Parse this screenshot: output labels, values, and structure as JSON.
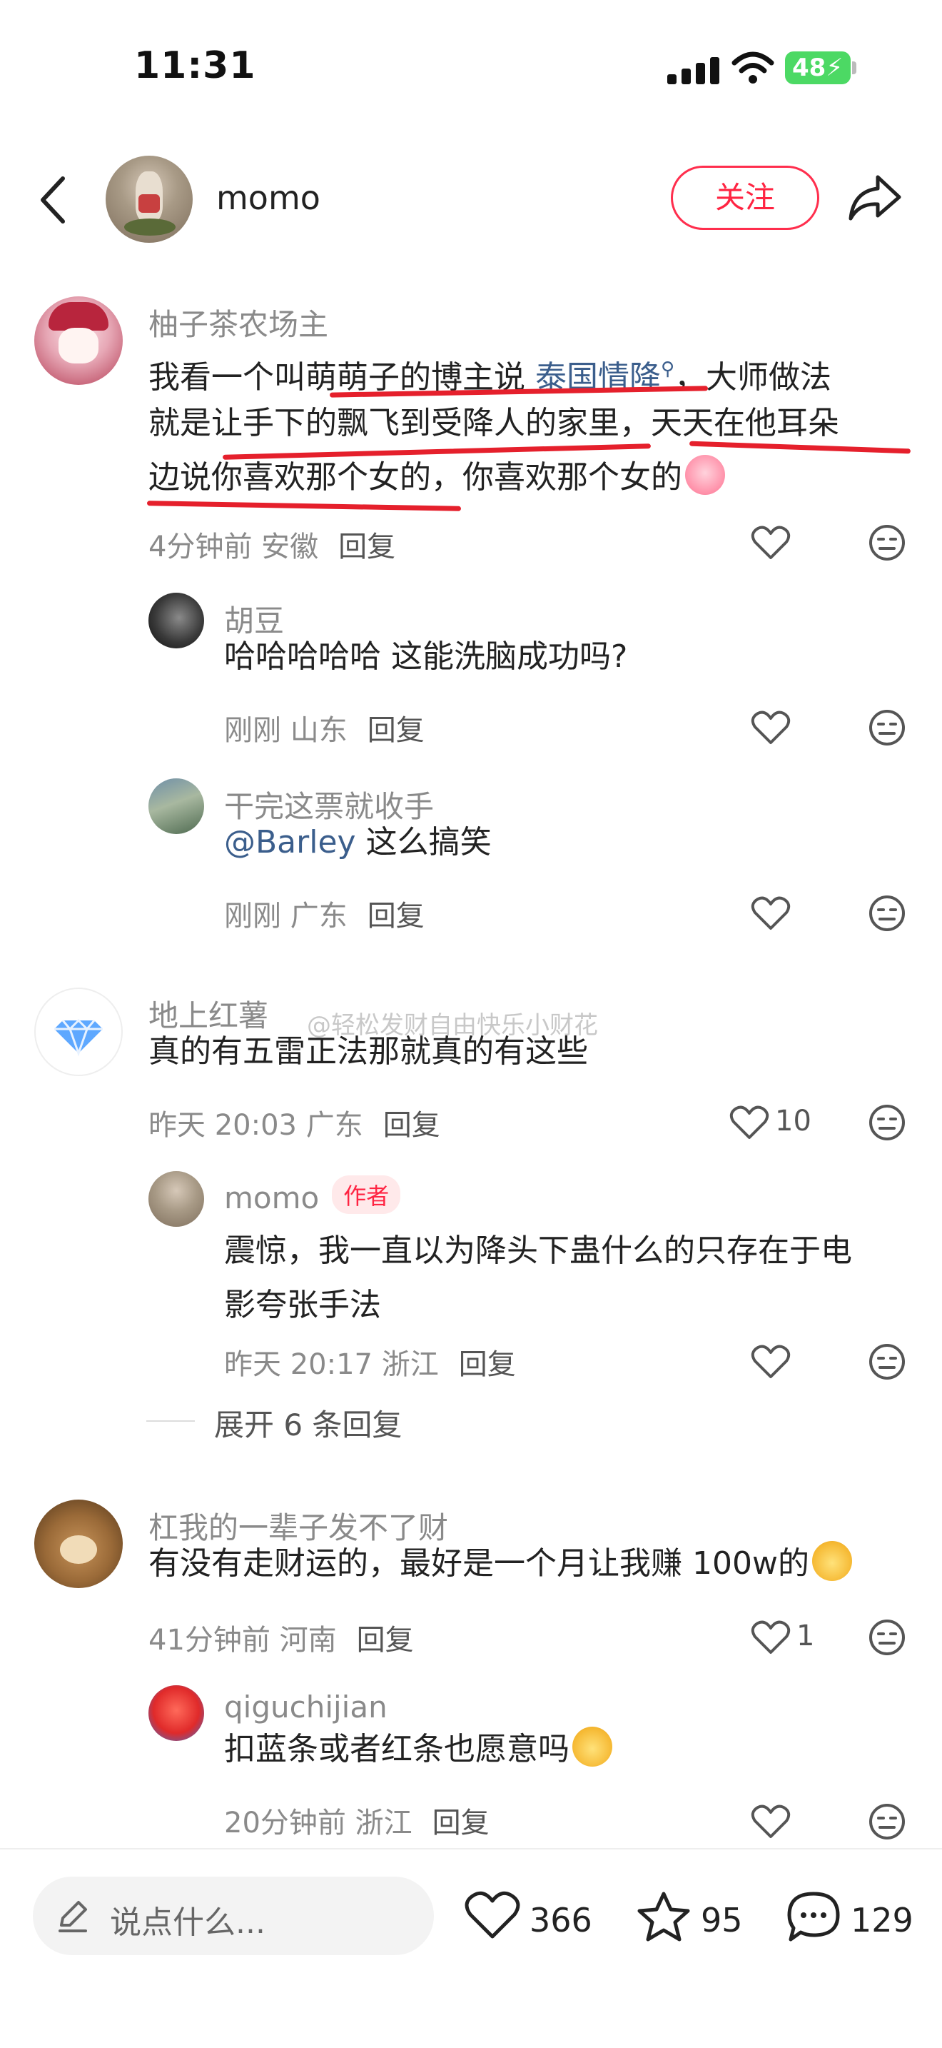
{
  "status_bar": {
    "time": "11:31",
    "battery": "48"
  },
  "header": {
    "author": "momo",
    "follow_label": "关注"
  },
  "comments": [
    {
      "nick": "柚子茶农场主",
      "text_line1_pre": "我看一个叫萌萌子的博主说 ",
      "text_line1_link": "泰国情降",
      "text_line1_post": "，大师做法",
      "text_line2": "就是让手下的飘飞到受降人的家里，天天在他耳朵",
      "text_line3": "边说你喜欢那个女的，你喜欢那个女的",
      "time": "4分钟前 安徽",
      "reply": "回复"
    },
    {
      "nick": "胡豆",
      "text": "哈哈哈哈哈 这能洗脑成功吗?",
      "time": "刚刚 山东",
      "reply": "回复"
    },
    {
      "nick": "干完这票就收手",
      "mention": "@Barley",
      "text": " 这么搞笑",
      "time": "刚刚 广东",
      "reply": "回复"
    },
    {
      "nick": "地上红薯",
      "text": "真的有五雷正法那就真的有这些",
      "time": "昨天 20:03 广东",
      "reply": "回复",
      "likes": "10"
    },
    {
      "nick": "momo",
      "author_tag": "作者",
      "text_line1": "震惊，我一直以为降头下蛊什么的只存在于电",
      "text_line2": "影夸张手法",
      "time": "昨天 20:17 浙江",
      "reply": "回复"
    },
    {
      "nick": "杠我的一辈子发不了财",
      "text": "有没有走财运的，最好是一个月让我赚 100w的",
      "time": "41分钟前 河南",
      "reply": "回复",
      "likes": "1"
    },
    {
      "nick": "qiguchijian",
      "text": "扣蓝条或者红条也愿意吗",
      "time": "20分钟前 浙江",
      "reply": "回复"
    }
  ],
  "expand_replies": "展开 6 条回复",
  "watermark": "@轻松发财自由快乐小财花",
  "bottom_bar": {
    "input_placeholder": "说点什么...",
    "likes": "366",
    "stars": "95",
    "comments": "129"
  }
}
